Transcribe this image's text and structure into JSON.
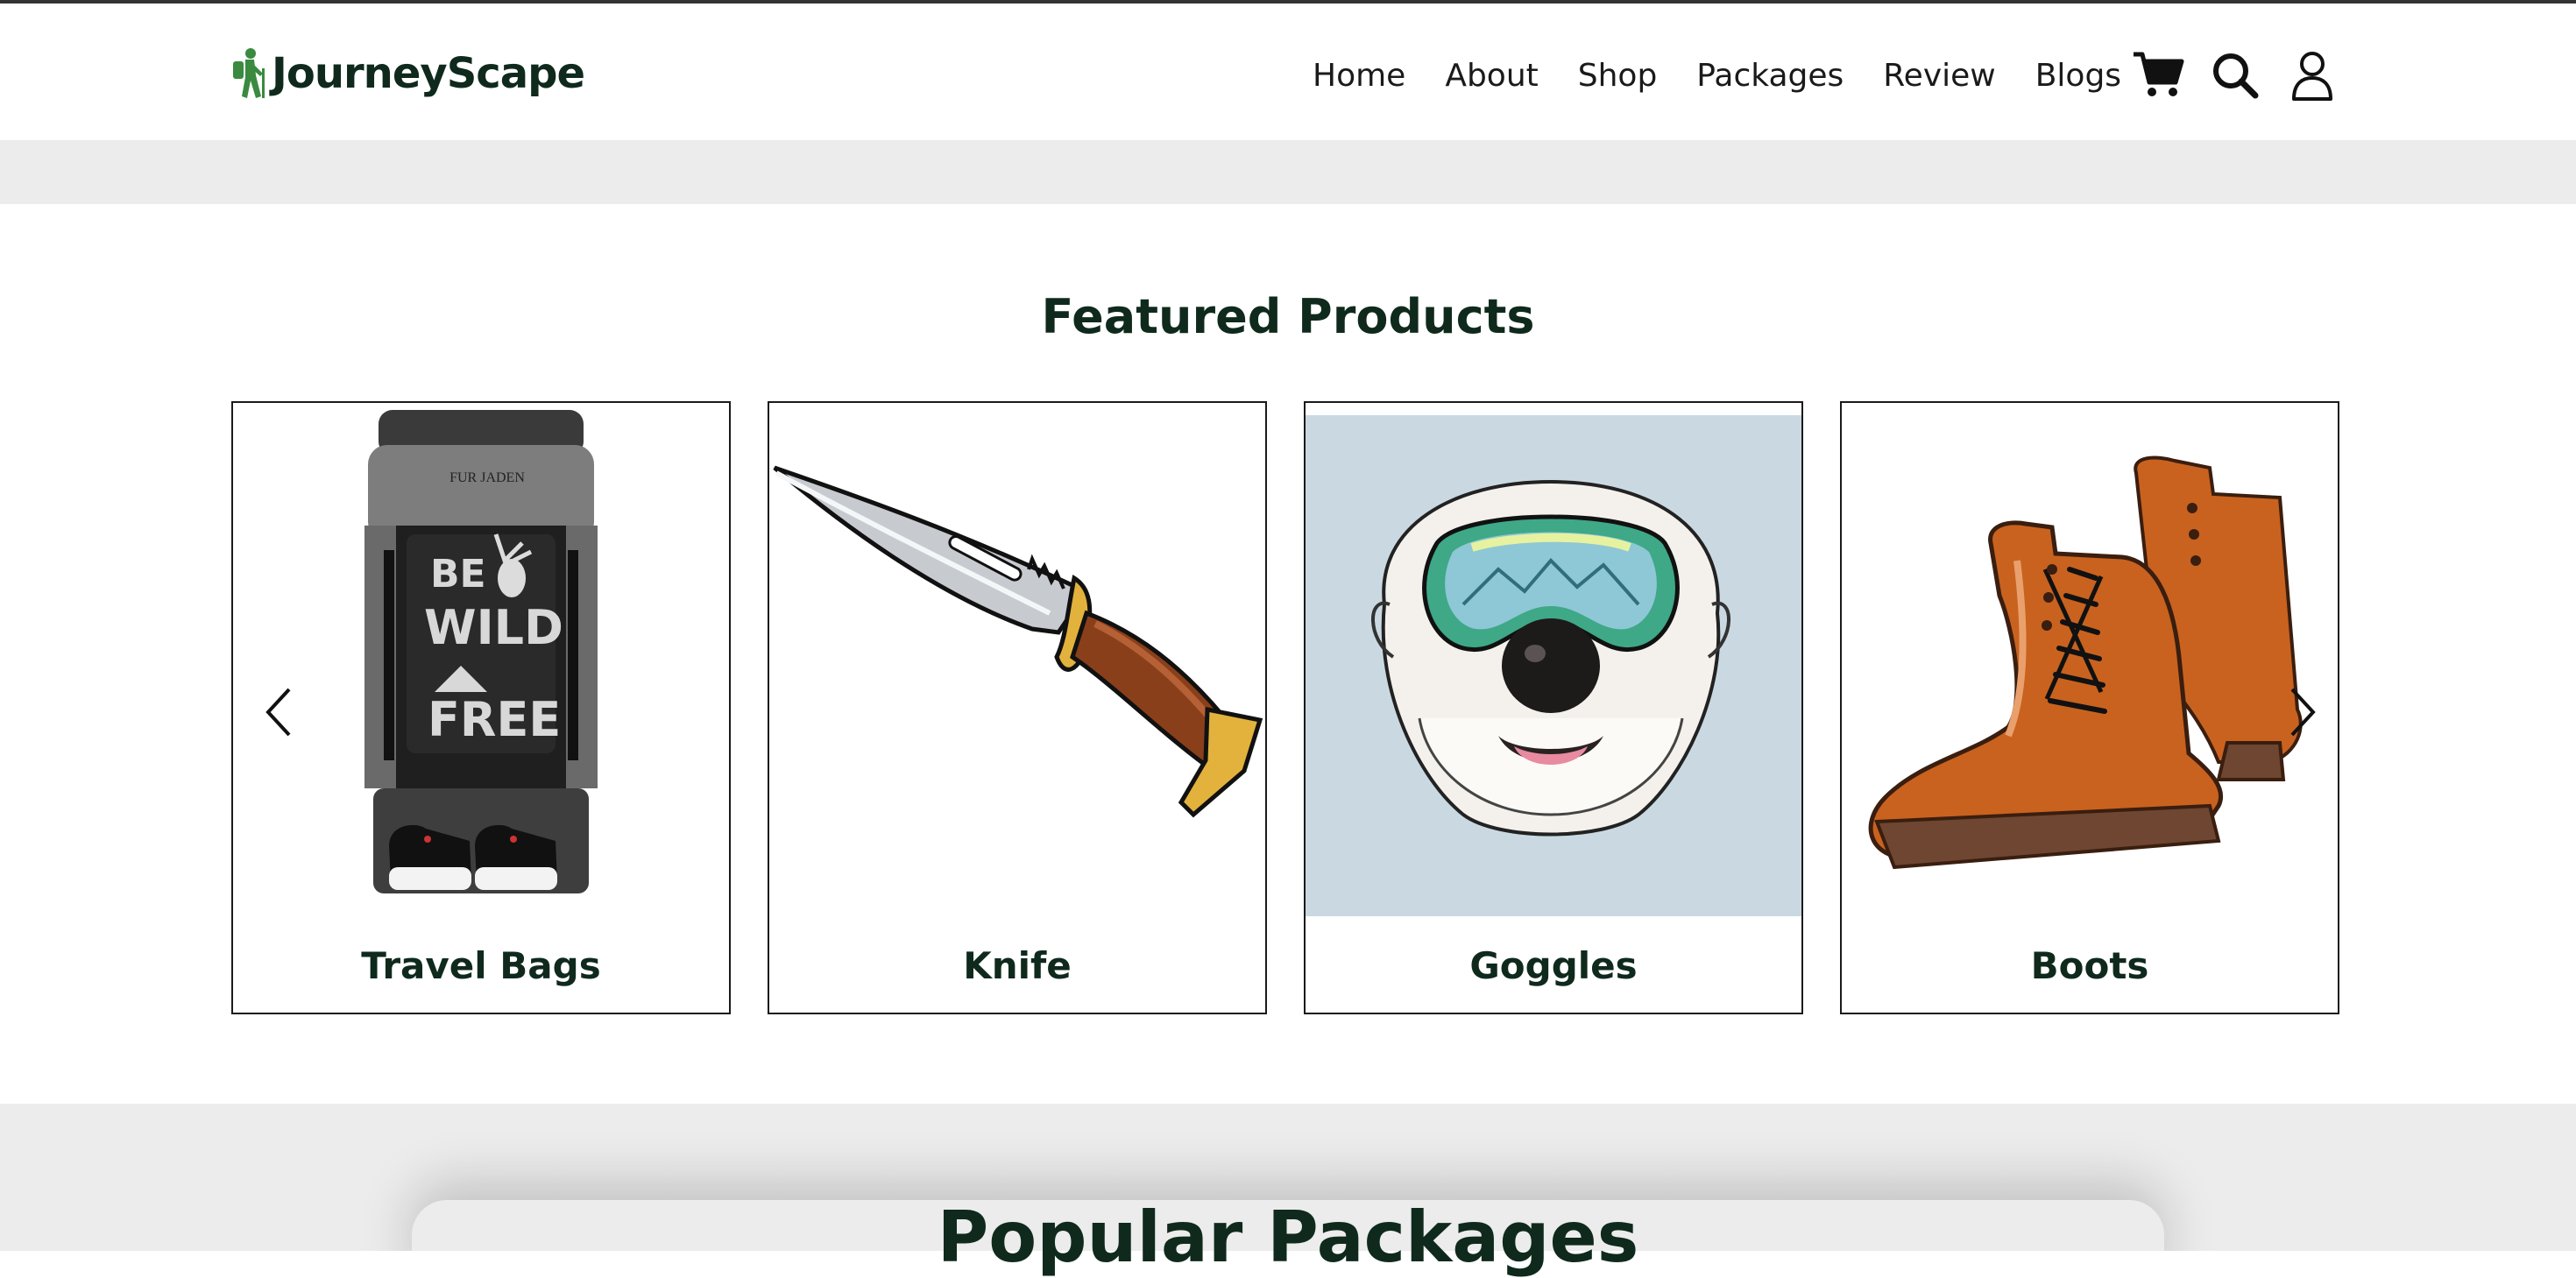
{
  "brand": {
    "name": "JourneyScape",
    "accent": "#3a8a3f",
    "dark": "#0f2a1d"
  },
  "nav": {
    "items": [
      "Home",
      "About",
      "Shop",
      "Packages",
      "Review",
      "Blogs"
    ]
  },
  "header_icons": [
    "cart-icon",
    "search-icon",
    "user-icon"
  ],
  "featured": {
    "title": "Featured Products",
    "products": [
      {
        "label": "Travel Bags",
        "image": "backpack"
      },
      {
        "label": "Knife",
        "image": "knife"
      },
      {
        "label": "Goggles",
        "image": "dog-with-goggles"
      },
      {
        "label": "Boots",
        "image": "boots"
      }
    ],
    "prev_icon": "chevron-left-icon",
    "next_icon": "chevron-right-icon"
  },
  "popular": {
    "title": "Popular Packages"
  },
  "backpack_print": {
    "brand": "FUR JADEN",
    "line1": "BE",
    "line2": "WILD",
    "line3": "FREE"
  }
}
